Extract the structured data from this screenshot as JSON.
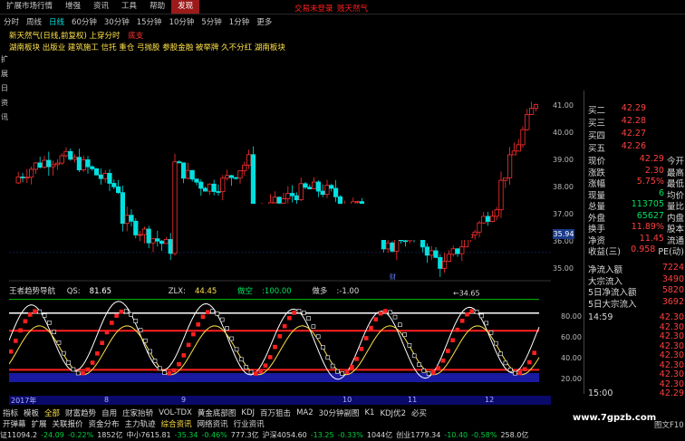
{
  "menu": {
    "items": [
      "扩展市场行情",
      "增强",
      "资讯",
      "工具",
      "帮助",
      "发现"
    ],
    "active": "发现",
    "red_links": [
      "交易未登录",
      "贱天然气"
    ]
  },
  "periods": [
    "分时",
    "周线",
    "日线",
    "60分钟",
    "30分钟",
    "15分钟",
    "10分钟",
    "5分钟",
    "1分钟",
    "更多"
  ],
  "period_active": "日线",
  "stock_title": {
    "name": "新天然气(日线,前复权) 上穿分时",
    "extra": "上穿分时",
    "extra2": "底支"
  },
  "concepts": "湖南板块 出版业 建筑施工 信托 重仓 弓抛股 参股金融 被举牌 久不分红 湖南板块",
  "left_edge_chars": [
    "扩",
    "展",
    "日",
    "资",
    "讯"
  ],
  "chart": {
    "y_ticks": [
      "41.00",
      "40.00",
      "39.00",
      "38.00",
      "37.00",
      "36.00",
      "35.00"
    ],
    "low_label": "34.65",
    "price_tag": "35.94",
    "candle_colors": {
      "up": "#ff3030",
      "down": "#00e0e0",
      "up_outline": "#ff3030"
    },
    "indicator_name": "王者趋势导航",
    "qs_label": "QS:",
    "qs_value": "81.65",
    "zlx_label": "ZLX:",
    "zlx_value": "44.45",
    "zuokong": "做空",
    "zuokong_value": "100.00",
    "zuoduo": "做多",
    "zuoduo_value": "-1.00",
    "ind_ticks": [
      "80.00",
      "60.00",
      "40.00",
      "20.00"
    ],
    "date_labels": [
      "2017年",
      "8",
      "9",
      "10",
      "11",
      "12"
    ]
  },
  "tabs_row1": [
    "指标",
    "模板",
    "全部",
    "财富趋势",
    "自用",
    "庄家抬轿",
    "VOL-TDX",
    "黄金底部图",
    "KDJ",
    "百万狙击",
    "MA2",
    "30分钟副图",
    "K1",
    "KDJ优2",
    "必买"
  ],
  "tabs_row1_active": "全部",
  "tabs_row2": [
    "开弹幕",
    "扩展",
    "关联报价",
    "资金分布",
    "主力轨迹",
    "综合资讯",
    "网络资讯",
    "行业资讯"
  ],
  "tabs_row2_active": "综合资讯",
  "quote": {
    "buy_levels": [
      {
        "label": "买二",
        "value": "42.29"
      },
      {
        "label": "买三",
        "value": "42.28"
      },
      {
        "label": "买四",
        "value": "42.27"
      },
      {
        "label": "买五",
        "value": "42.26"
      }
    ],
    "rows": [
      {
        "l1": "现价",
        "v1": "42.29",
        "l2": "今开"
      },
      {
        "l1": "涨跌",
        "v1": "2.30",
        "l2": "最高"
      },
      {
        "l1": "涨幅",
        "v1": "5.75%",
        "l2": "最低"
      },
      {
        "l1": "现量",
        "v1": "6",
        "l2": "均价"
      },
      {
        "l1": "总量",
        "v1": "113705",
        "l2": "量比"
      },
      {
        "l1": "外盘",
        "v1": "65627",
        "l2": "内盘"
      },
      {
        "l1": "换手",
        "v1": "11.89%",
        "l2": "股本"
      },
      {
        "l1": "净资",
        "v1": "11.45",
        "l2": "流通"
      },
      {
        "l1": "收益(三)",
        "v1": "0.958",
        "l2": "PE(动)"
      }
    ],
    "flows": [
      {
        "label": "净流入额",
        "value": "7224"
      },
      {
        "label": "大宗流入",
        "value": "3490"
      },
      {
        "label": "5日净流入额",
        "value": "5820"
      },
      {
        "label": "5日大宗流入",
        "value": "3692"
      }
    ],
    "ticks": [
      {
        "time": "14:59",
        "price": "42.30"
      },
      {
        "time": "",
        "price": "42.30"
      },
      {
        "time": "",
        "price": "42.30"
      },
      {
        "time": "",
        "price": "42.30"
      },
      {
        "time": "",
        "price": "42.30"
      },
      {
        "time": "",
        "price": "42.30"
      },
      {
        "time": "",
        "price": "42.30"
      },
      {
        "time": "",
        "price": "42.30"
      },
      {
        "time": "15:00",
        "price": "42.29"
      }
    ]
  },
  "bottom_bar": [
    {
      "text": "证11094.2",
      "c": "bb-wht"
    },
    {
      "text": "-24.09",
      "c": "bb-grn"
    },
    {
      "text": "-0.22%",
      "c": "bb-grn"
    },
    {
      "text": "1852亿",
      "c": "bb-wht"
    },
    {
      "text": "中小7615.81",
      "c": "bb-wht"
    },
    {
      "text": "-35.34",
      "c": "bb-grn"
    },
    {
      "text": "-0.46%",
      "c": "bb-grn"
    },
    {
      "text": "777.3亿",
      "c": "bb-wht"
    },
    {
      "text": "沪深4054.60",
      "c": "bb-wht"
    },
    {
      "text": "-13.25",
      "c": "bb-grn"
    },
    {
      "text": "-0.33%",
      "c": "bb-grn"
    },
    {
      "text": "1044亿",
      "c": "bb-wht"
    },
    {
      "text": "创业1779.34",
      "c": "bb-wht"
    },
    {
      "text": "-10.40",
      "c": "bb-grn"
    },
    {
      "text": "-0.58%",
      "c": "bb-grn"
    },
    {
      "text": "258.0亿",
      "c": "bb-wht"
    }
  ],
  "watermark": "www.7gpzb.com",
  "tujie": "图文F10"
}
